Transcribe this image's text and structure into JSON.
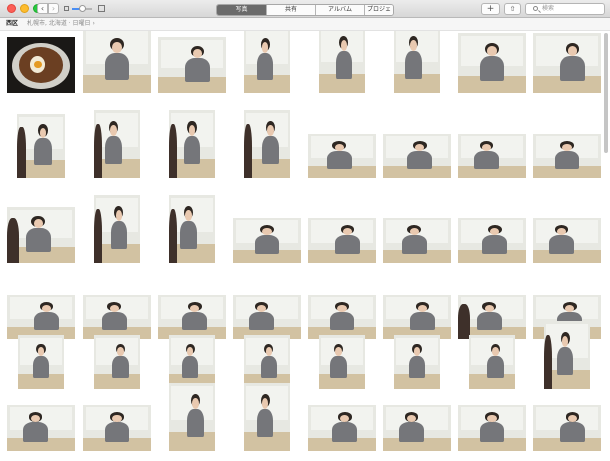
{
  "window": {
    "title_tabs": [
      {
        "label": "写真",
        "selected": true
      },
      {
        "label": "共有",
        "selected": false
      },
      {
        "label": "アルバム",
        "selected": false
      },
      {
        "label": "プロジェクト",
        "selected": false
      }
    ],
    "back_label": "‹",
    "forward_label": "›",
    "add_label": "+",
    "share_label": "⇧",
    "search_placeholder": "検索"
  },
  "location": {
    "title": "西区",
    "subtitle": "札幌市, 北海道 · 日曜日 ›"
  },
  "photos": {
    "rows": 6,
    "per_row": 8,
    "count": 48,
    "kinds": [
      "food",
      "photo",
      "photo",
      "photo",
      "photo",
      "photo",
      "photo",
      "photo",
      "photo",
      "photo",
      "photo",
      "photo",
      "photo",
      "photo",
      "photo",
      "photo",
      "photo",
      "photo",
      "photo",
      "photo",
      "photo",
      "photo",
      "photo",
      "photo",
      "photo",
      "photo",
      "photo",
      "photo",
      "photo",
      "photo",
      "photo",
      "photo",
      "photo",
      "photo",
      "photo",
      "photo",
      "photo",
      "photo",
      "photo",
      "photo",
      "photo",
      "photo",
      "photo",
      "photo",
      "photo",
      "photo",
      "photo",
      "photo"
    ]
  },
  "colors": {
    "accent": "#4a8ef3",
    "selected_tab": "#6b6b6b",
    "close": "#fc5f57",
    "minimize": "#fdbc2e",
    "maximize": "#28c840"
  }
}
